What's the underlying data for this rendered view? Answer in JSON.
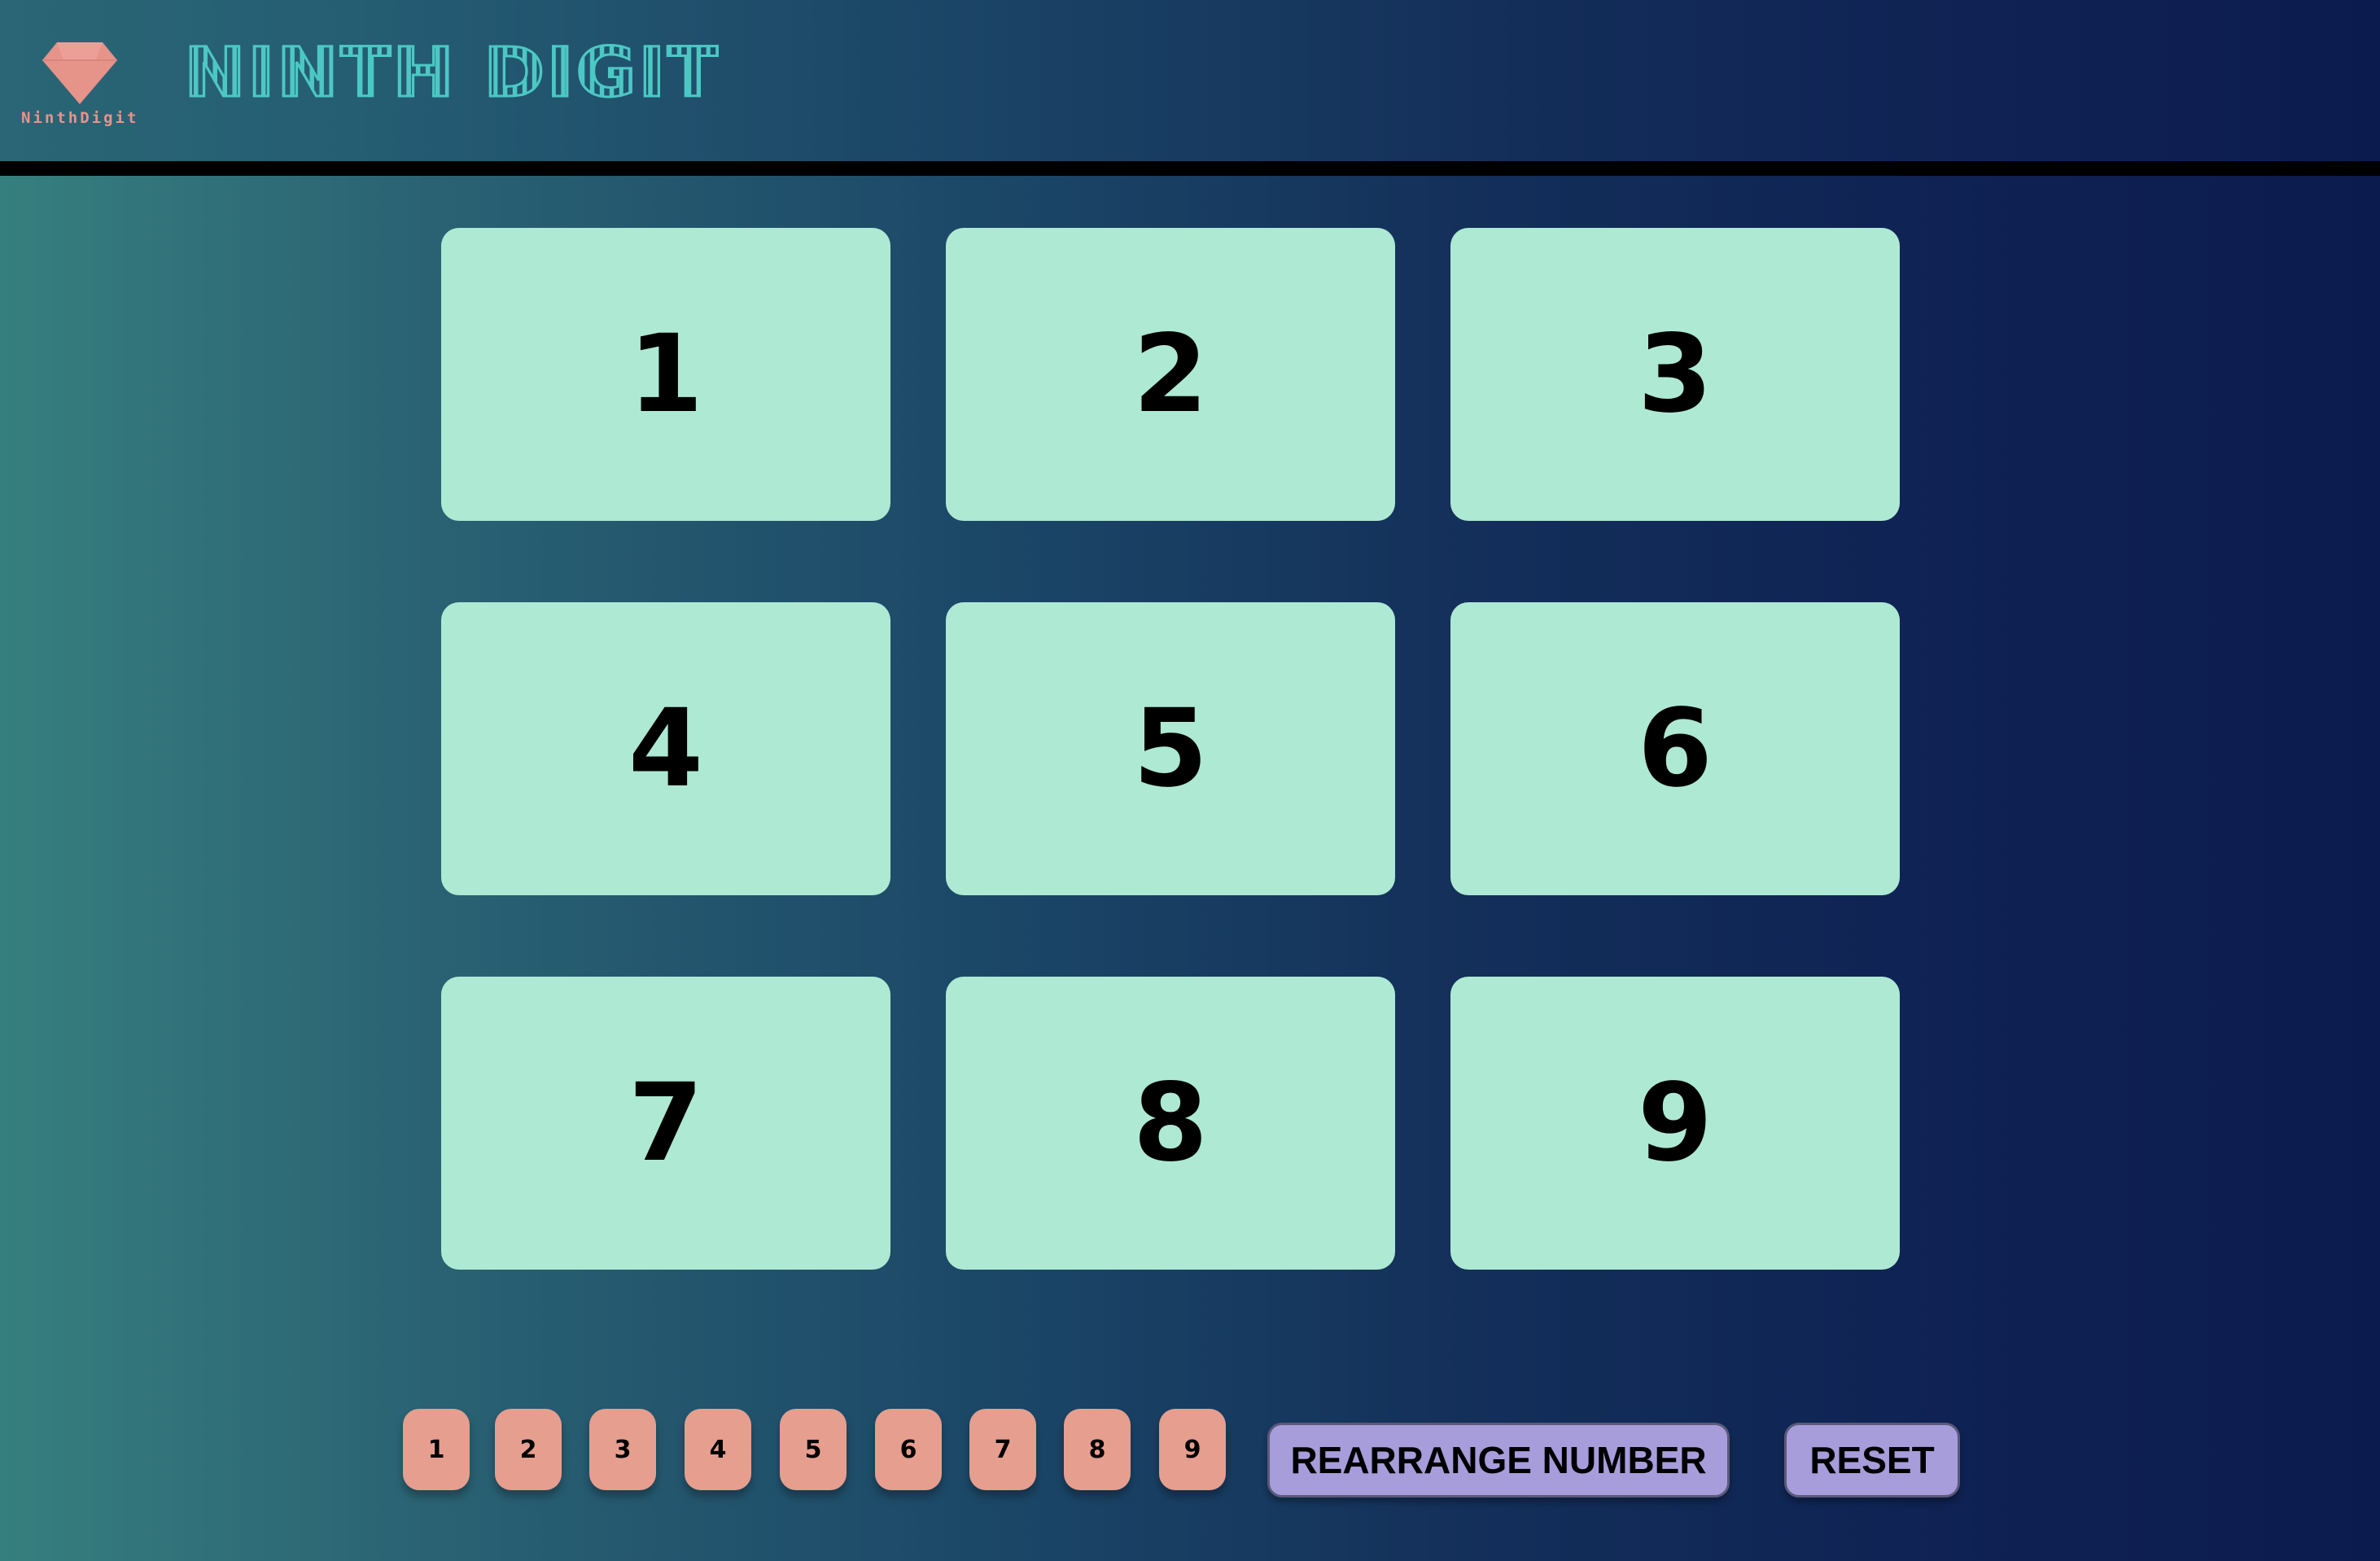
{
  "header": {
    "logo_text": "NinthDigit",
    "title": "NINTH DIGIT",
    "logo_icon": "diamond-icon"
  },
  "board": {
    "cells": [
      "1",
      "2",
      "3",
      "4",
      "5",
      "6",
      "7",
      "8",
      "9"
    ]
  },
  "controls": {
    "chips": [
      "1",
      "2",
      "3",
      "4",
      "5",
      "6",
      "7",
      "8",
      "9"
    ],
    "rearrange_label": "REARRANGE NUMBER",
    "reset_label": "RESET"
  },
  "colors": {
    "cell": "#aee9d3",
    "chip": "#e69e8f",
    "button": "#a89ddb",
    "brand": "#4cc8c4",
    "logo": "#e6938a"
  }
}
